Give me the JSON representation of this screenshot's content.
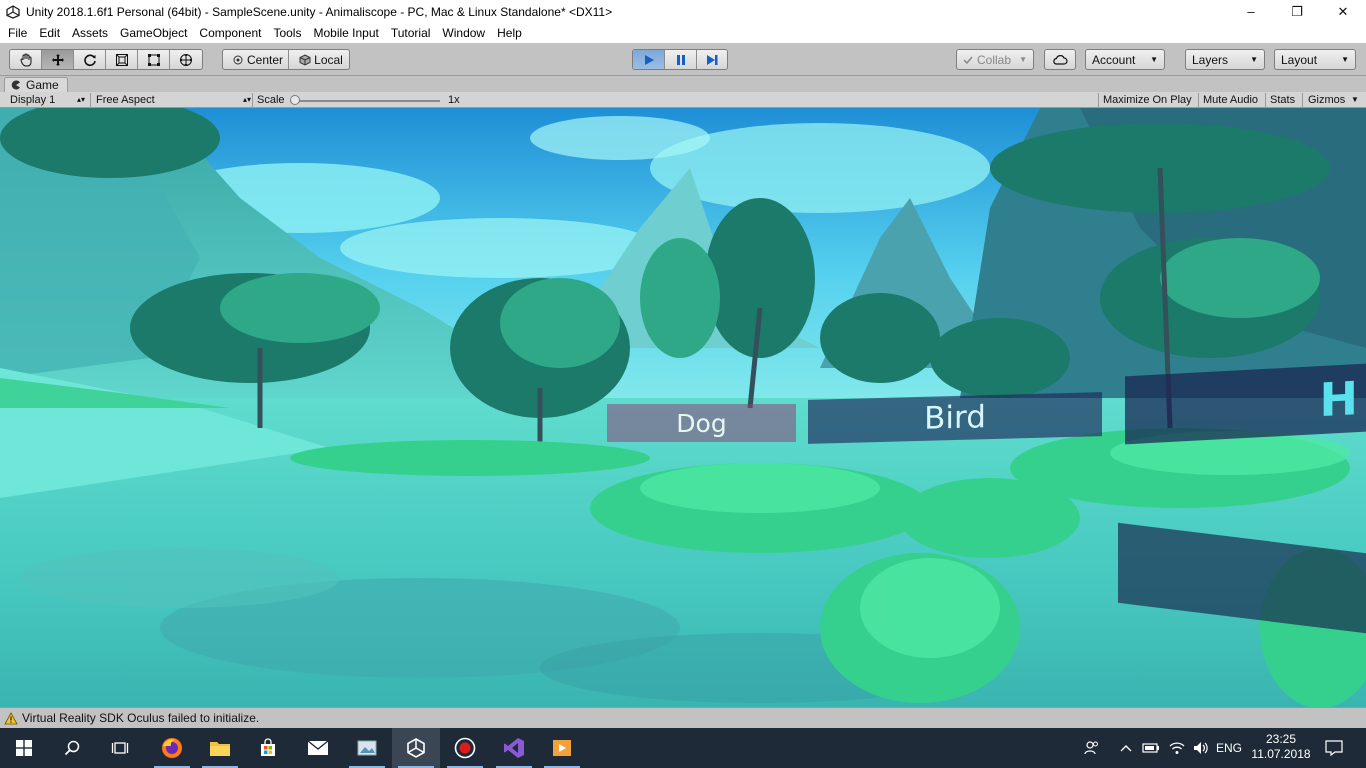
{
  "window": {
    "title": "Unity 2018.1.6f1 Personal (64bit) - SampleScene.unity - Animaliscope - PC, Mac & Linux Standalone* <DX11>",
    "minimize": "–",
    "maximize": "❐",
    "close": "✕"
  },
  "menu": [
    "File",
    "Edit",
    "Assets",
    "GameObject",
    "Component",
    "Tools",
    "Mobile Input",
    "Tutorial",
    "Window",
    "Help"
  ],
  "toolbar": {
    "pivot_center": "Center",
    "pivot_local": "Local",
    "collab": "Collab",
    "account": "Account",
    "layers": "Layers",
    "layout": "Layout",
    "play_state": "playing",
    "active_tool": "move"
  },
  "game_tab": {
    "label": "Game"
  },
  "game_bar": {
    "display": "Display 1",
    "aspect": "Free Aspect",
    "scale_label": "Scale",
    "scale_value": "1x",
    "maximize_on_play": "Maximize On Play",
    "mute_audio": "Mute Audio",
    "stats": "Stats",
    "gizmos": "Gizmos"
  },
  "scene_labels": {
    "dog": "Dog",
    "bird": "Bird",
    "partial": "H"
  },
  "status": {
    "message": "Virtual Reality SDK Oculus failed to initialize."
  },
  "taskbar": {
    "language": "ENG",
    "time": "23:25",
    "date": "11.07.2018"
  },
  "colors": {
    "accent_play": "#7fa8d8",
    "scene_sky": "#35c4e4",
    "scene_ground": "#4fe0d2"
  }
}
